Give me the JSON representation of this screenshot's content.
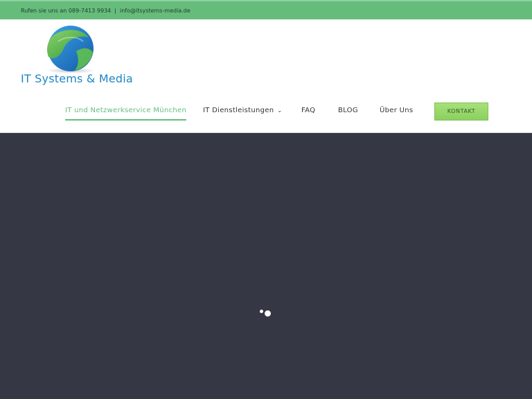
{
  "topbar": {
    "phone_text": "Rufen sie uns an 089-7413 9934",
    "separator": "|",
    "email": "info@itsystems-media.de"
  },
  "logo": {
    "text": "IT Systems & Media",
    "icon": "globe-icon",
    "colors": {
      "blue": "#1e86c2",
      "green": "#3fae49"
    }
  },
  "nav": {
    "items": [
      {
        "label": "IT und Netzwerkservice München",
        "active": true
      },
      {
        "label": "IT Dienstleistungen",
        "has_dropdown": true
      },
      {
        "label": "FAQ"
      },
      {
        "label": "BLOG"
      },
      {
        "label": "Über Uns"
      }
    ],
    "cta_label": "KONTAKT"
  },
  "colors": {
    "accent": "#65bc7b",
    "cta": "#8ccf5f",
    "hero_bg": "#353744"
  }
}
